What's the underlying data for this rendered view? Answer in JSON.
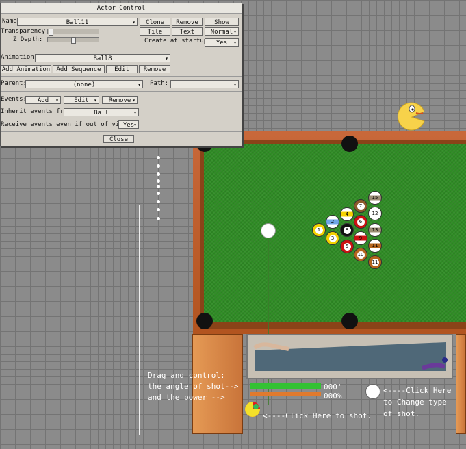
{
  "dialog": {
    "title": "Actor Control",
    "name_label": "Name:",
    "name_value": "Ball11",
    "clone_label": "Clone",
    "remove_label": "Remove",
    "show_label": "Show",
    "transparency_label": "Transparency:",
    "zdepth_label": "Z Depth:",
    "tile_label": "Tile",
    "text_label": "Text",
    "normal_label": "Normal",
    "create_at_startup_label": "Create at startup:",
    "create_at_startup_value": "Yes",
    "animation_label": "Animation:",
    "animation_value": "Ball8",
    "add_animation_label": "Add Animation",
    "add_sequence_label": "Add Sequence",
    "edit_label": "Edit",
    "remove_anim_label": "Remove",
    "parent_label": "Parent:",
    "parent_value": "(none)",
    "path_label": "Path:",
    "path_value": "",
    "events_label": "Events:",
    "events_add": "Add",
    "events_edit": "Edit",
    "events_remove": "Remove",
    "inherit_label": "Inherit events from:",
    "inherit_value": "Ball",
    "receive_label": "Receive events even if out of vision:",
    "receive_value": "Yes",
    "close_label": "Close"
  },
  "balls": [
    {
      "n": "1",
      "color": "#f4d200",
      "stripe": false
    },
    {
      "n": "2",
      "color": "#6fa6e8",
      "stripe": true
    },
    {
      "n": "3",
      "color": "#f4d200",
      "stripe": false
    },
    {
      "n": "4",
      "color": "#f4d200",
      "stripe": true
    },
    {
      "n": "5",
      "color": "#cc1111",
      "stripe": false
    },
    {
      "n": "6",
      "color": "#cc1111",
      "stripe": false
    },
    {
      "n": "7",
      "color": "#8c5a2b",
      "stripe": false
    },
    {
      "n": "8",
      "color": "#111111",
      "stripe": false
    },
    {
      "n": "9",
      "color": "#cc1111",
      "stripe": true
    },
    {
      "n": "10",
      "color": "#b5651d",
      "stripe": false
    },
    {
      "n": "11",
      "color": "#b5651d",
      "stripe": false
    },
    {
      "n": "12",
      "color": "#ffffff",
      "stripe": false
    },
    {
      "n": "13",
      "color": "#9c8e74",
      "stripe": true
    },
    {
      "n": "15",
      "color": "#9c8e74",
      "stripe": true
    },
    {
      "n": "11",
      "color": "#b5651d",
      "stripe": true
    }
  ],
  "hud": {
    "drag_text_1": "Drag and control:",
    "drag_text_2": "the angle of shot-->",
    "drag_text_3": "and the power    -->",
    "angle_value": "000'",
    "power_value": "000%",
    "shoot_text": "<----Click Here to shot.",
    "change_text_1": "<----Click Here",
    "change_text_2": "to Change type",
    "change_text_3": "of shot."
  },
  "colors": {
    "felt": "#2f8c25",
    "rail": "#c8683a",
    "dialog_bg": "#d4d0c8"
  }
}
